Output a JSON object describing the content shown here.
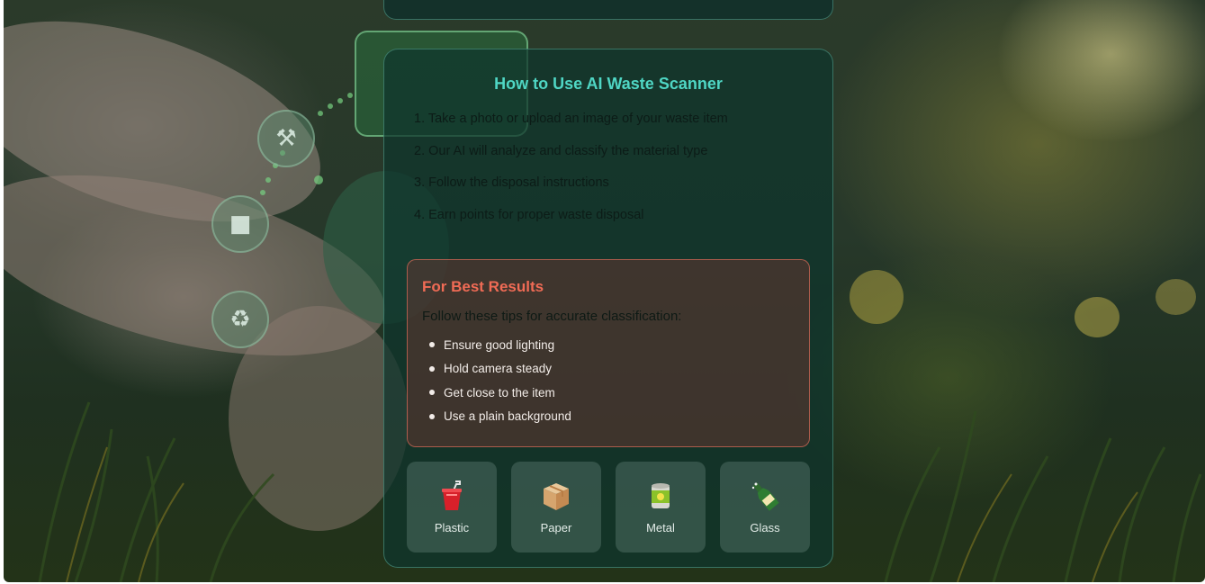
{
  "guide": {
    "title": "How to Use AI Waste Scanner",
    "steps": [
      "1. Take a photo or upload an image of your waste item",
      "2. Our AI will analyze and classify the material type",
      "3. Follow the disposal instructions",
      "4. Earn points for proper waste disposal"
    ]
  },
  "tips": {
    "title": "For Best Results",
    "intro": "Follow these tips for accurate classification:",
    "items": [
      "Ensure good lighting",
      "Hold camera steady",
      "Get close to the item",
      "Use a plain background"
    ]
  },
  "materials": [
    {
      "label": "Plastic",
      "icon": "plastic-cup-icon"
    },
    {
      "label": "Paper",
      "icon": "cardboard-box-icon"
    },
    {
      "label": "Metal",
      "icon": "tin-can-icon"
    },
    {
      "label": "Glass",
      "icon": "glass-bottle-icon"
    }
  ],
  "colors": {
    "title_accent": "#4fd6c4",
    "tips_accent": "#f06b55",
    "card_border": "#5aaa96"
  }
}
